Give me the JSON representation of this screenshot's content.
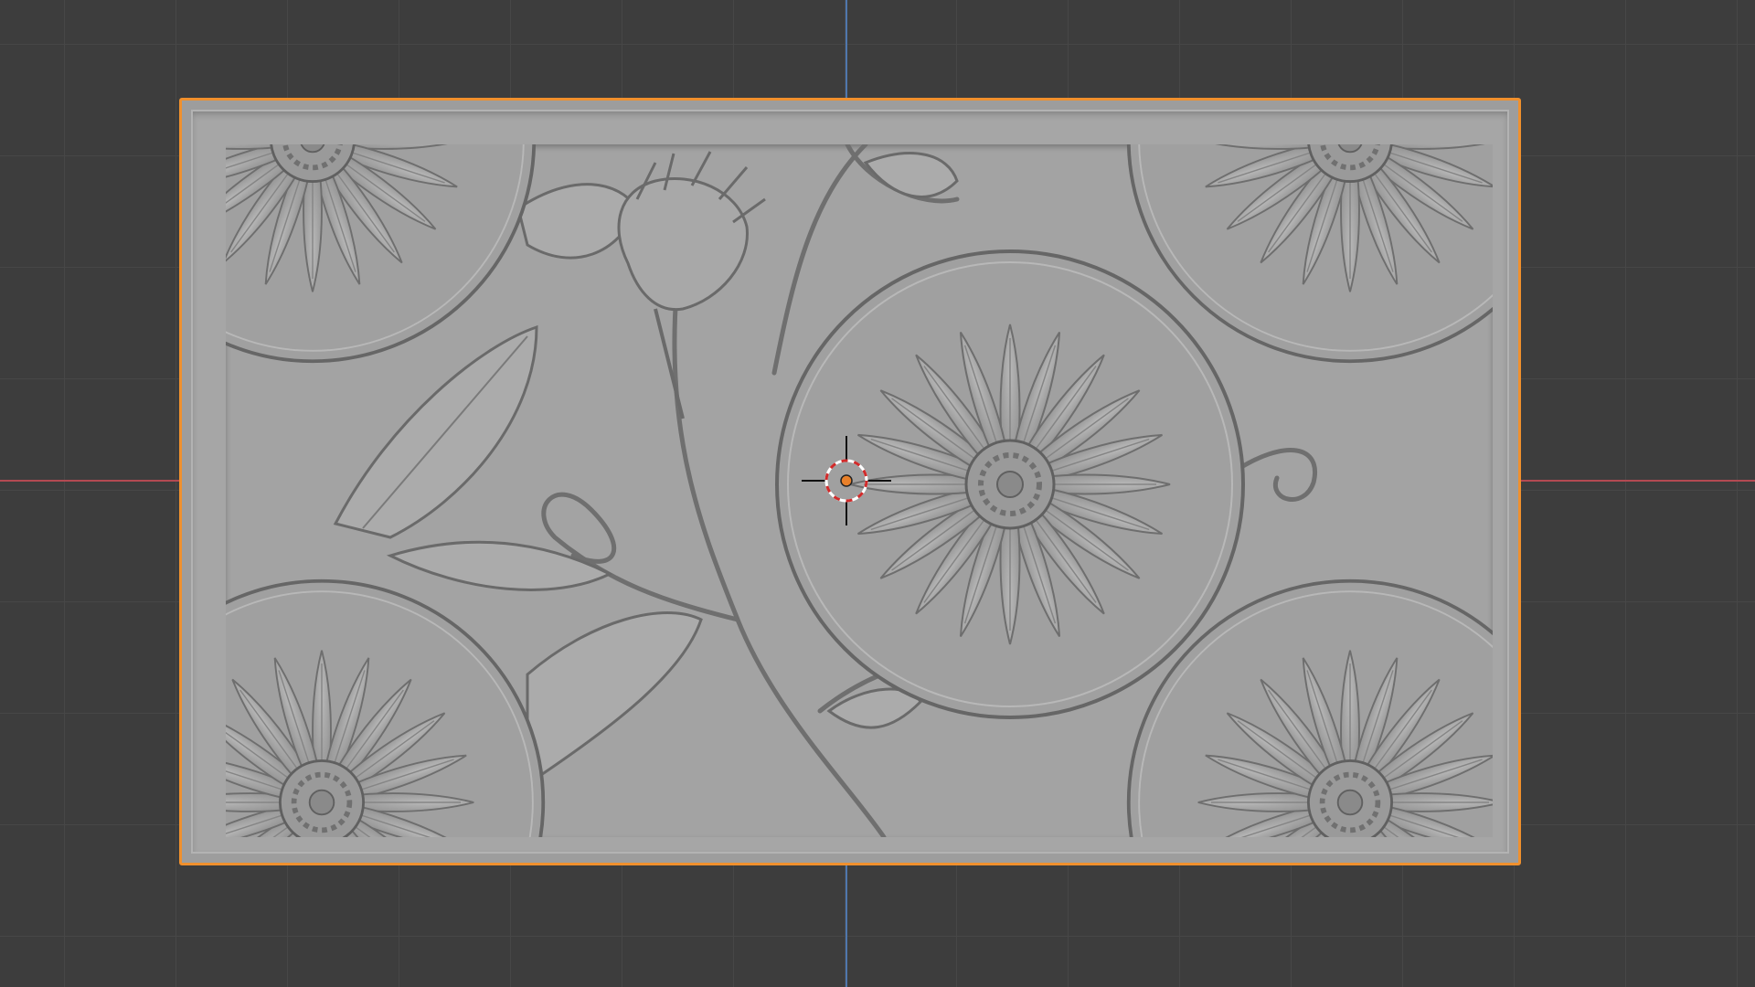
{
  "viewport": {
    "background_color": "#3d3d3d",
    "grid_color": "#474747",
    "x_axis_color": "#b34a52",
    "y_axis_color": "#4f77ad"
  },
  "selected_object": {
    "name_shown": false,
    "selection_outline_color": "#f0902d",
    "material_color": "#a3a3a3",
    "relief_pattern": "floral-daisy-carving"
  },
  "cursor": {
    "icon": "3d-cursor-icon",
    "origin_color": "#e8802a"
  }
}
